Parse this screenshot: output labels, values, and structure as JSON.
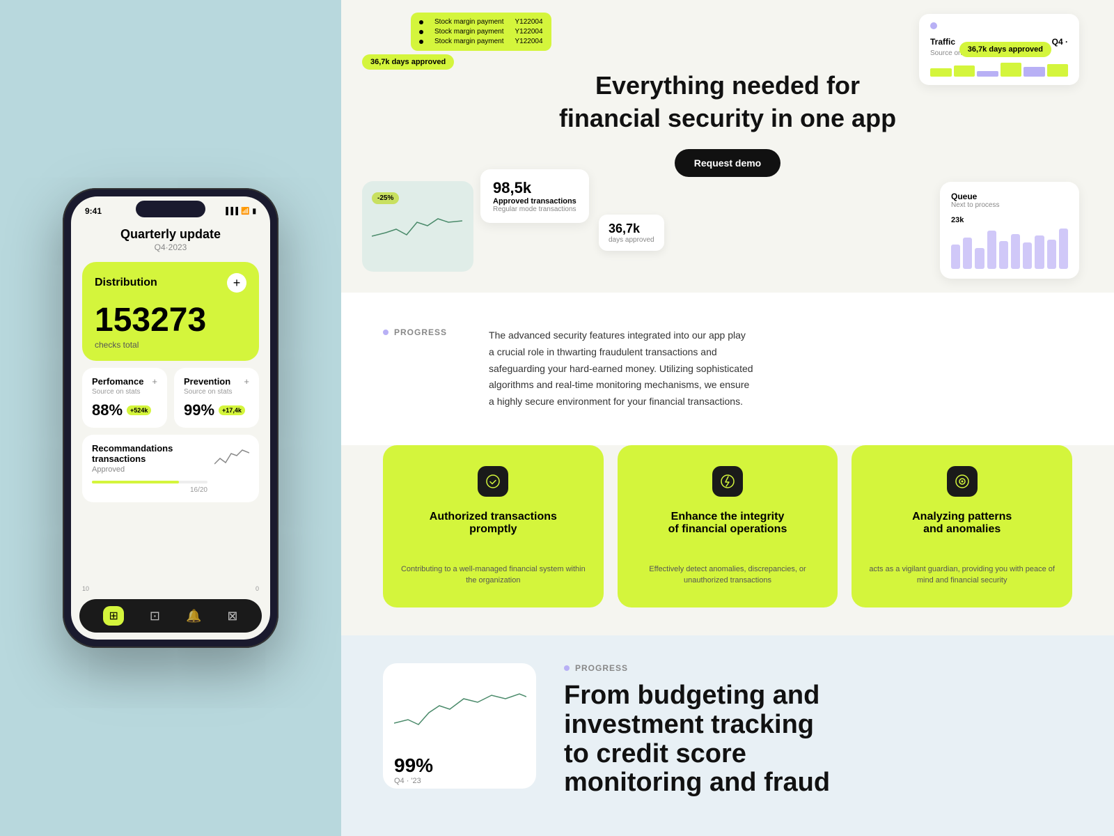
{
  "background": "#b8d8dd",
  "phone": {
    "time": "9:41",
    "header_title": "Quarterly update",
    "header_sub": "Q4·2023",
    "distribution": {
      "label": "Distribution",
      "plus": "+",
      "number": "153273",
      "sub_label": "checks total"
    },
    "performance": {
      "title": "Perfomance",
      "plus": "+",
      "source": "Source on stats",
      "value": "88%",
      "badge": "+524k"
    },
    "prevention": {
      "title": "Prevention",
      "plus": "+",
      "source": "Source on stats",
      "value": "99%",
      "badge": "+17,4k"
    },
    "recommendations": {
      "title": "Recommandations transactions",
      "subtitle": "Approved",
      "progress": "16/20"
    },
    "bottom_nav": {
      "items": [
        "⊞",
        "⊡",
        "🔔",
        "⊠"
      ],
      "page_start": "10",
      "page_end": "0"
    }
  },
  "web": {
    "hero": {
      "title": "Everything needed for\nfinancial security in one app",
      "cta_label": "Request demo",
      "stock_card": {
        "rows": [
          {
            "label": "Stock margin payment",
            "value": "Y122004"
          },
          {
            "label": "Stock margin payment",
            "value": "Y122004"
          },
          {
            "label": "Stock margin payment",
            "value": "Y122004"
          }
        ]
      },
      "days_badge_1": "36,7k  days approved",
      "traffic_title": "Traffic",
      "traffic_source": "Source on stats",
      "traffic_quarter": "Q4 ·",
      "days_badge_2": "36,7k  days approved",
      "chart_badge": "-25%",
      "approved_number": "98,5k",
      "approved_label": "Approved transactions",
      "approved_sub": "Regular mode transactions",
      "days_number": "36,7k",
      "days_label": "days approved",
      "queue_title": "Queue",
      "queue_sub": "Next to process",
      "queue_number": "23k"
    },
    "progress": {
      "label": "PROGRESS",
      "text": "The advanced security features integrated into our app play a crucial role in thwarting fraudulent transactions and safeguarding your hard-earned money. Utilizing sophisticated algorithms and real-time monitoring mechanisms, we ensure a highly secure environment for your financial transactions."
    },
    "features": [
      {
        "icon": "✓",
        "title": "Authorized transactions\npromptly",
        "desc": "Contributing to a well-managed financial system within the organization"
      },
      {
        "icon": "⚡",
        "title": "Enhance the integrity\nof financial operations",
        "desc": "Effectively detect anomalies, discrepancies, or unauthorized transactions"
      },
      {
        "icon": "◎",
        "title": "Analyzing patterns\nand anomalies",
        "desc": "acts as a vigilant guardian, providing you with peace of mind and financial security"
      }
    ],
    "bottom": {
      "progress_label": "PROGRESS",
      "chart_percent": "99%",
      "chart_period": "Q4 · '23",
      "heading_line1": "From budgeting and",
      "heading_line2": "investment tracking",
      "heading_line3": "to credit score",
      "heading_line4": "monitoring and fraud"
    }
  }
}
